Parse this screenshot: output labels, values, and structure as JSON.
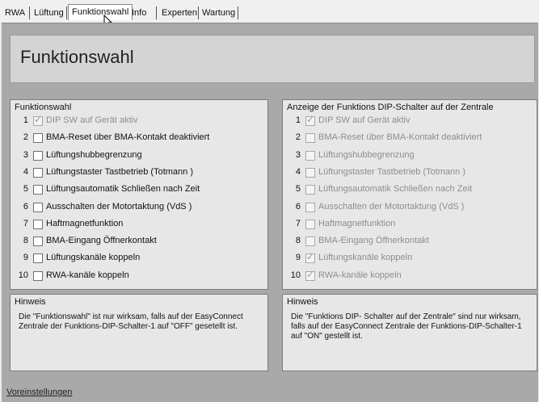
{
  "tabs": [
    "RWA",
    "Lüftung",
    "Funktionswahl",
    "Info",
    "Experten",
    "Wartung"
  ],
  "active_tab": "Funktionswahl",
  "page_title": "Funktionswahl",
  "left_group": {
    "title": "Funktionswahl",
    "items": [
      {
        "num": "1",
        "label": "DIP SW auf Gerät aktiv",
        "checked": true,
        "disabled": true
      },
      {
        "num": "2",
        "label": "BMA-Reset über BMA-Kontakt deaktiviert",
        "checked": false,
        "disabled": false
      },
      {
        "num": "3",
        "label": "Lüftungshubbegrenzung",
        "checked": false,
        "disabled": false
      },
      {
        "num": "4",
        "label": "Lüftungstaster Tastbetrieb (Totmann )",
        "checked": false,
        "disabled": false
      },
      {
        "num": "5",
        "label": "Lüftungsautomatik Schließen nach Zeit",
        "checked": false,
        "disabled": false
      },
      {
        "num": "6",
        "label": "Ausschalten der Motortaktung (VdS )",
        "checked": false,
        "disabled": false
      },
      {
        "num": "7",
        "label": "Haftmagnetfunktion",
        "checked": false,
        "disabled": false
      },
      {
        "num": "8",
        "label": "BMA-Eingang Öffnerkontakt",
        "checked": false,
        "disabled": false
      },
      {
        "num": "9",
        "label": "Lüftungskanäle koppeln",
        "checked": false,
        "disabled": false
      },
      {
        "num": "10",
        "label": "RWA-kanäle koppeln",
        "checked": false,
        "disabled": false
      }
    ]
  },
  "right_group": {
    "title": "Anzeige der Funktions DIP-Schalter auf  der Zentrale",
    "items": [
      {
        "num": "1",
        "label": "DIP SW auf Gerät aktiv",
        "checked": true,
        "disabled": true
      },
      {
        "num": "2",
        "label": "BMA-Reset über BMA-Kontakt deaktiviert",
        "checked": false,
        "disabled": true
      },
      {
        "num": "3",
        "label": "Lüftungshubbegrenzung",
        "checked": false,
        "disabled": true
      },
      {
        "num": "4",
        "label": "Lüftungstaster Tastbetrieb (Totmann )",
        "checked": false,
        "disabled": true
      },
      {
        "num": "5",
        "label": "Lüftungsautomatik Schließen nach Zeit",
        "checked": false,
        "disabled": true
      },
      {
        "num": "6",
        "label": "Ausschalten der Motortaktung (VdS )",
        "checked": false,
        "disabled": true
      },
      {
        "num": "7",
        "label": "Haftmagnetfunktion",
        "checked": false,
        "disabled": true
      },
      {
        "num": "8",
        "label": "BMA-Eingang Öffnerkontakt",
        "checked": false,
        "disabled": true
      },
      {
        "num": "9",
        "label": "Lüftungskanäle koppeln",
        "checked": true,
        "disabled": true
      },
      {
        "num": "10",
        "label": "RWA-kanäle koppeln",
        "checked": true,
        "disabled": true
      }
    ]
  },
  "left_hint": {
    "title": "Hinweis",
    "text": "Die \"Funktionswahl\" ist nur wirksam, falls auf der EasyConnect Zentrale der Funktions-DIP-Schalter-1 auf \"OFF\" gesetellt ist."
  },
  "right_hint": {
    "title": "Hinweis",
    "text": "Die \"Funktions DIP- Schalter auf der Zentrale\" sind nur wirksam, falls auf der EasyConnect Zentrale der Funktions-DIP-Schalter-1 auf \"ON\" gestellt ist."
  },
  "footer_link": "Voreinstellungen"
}
